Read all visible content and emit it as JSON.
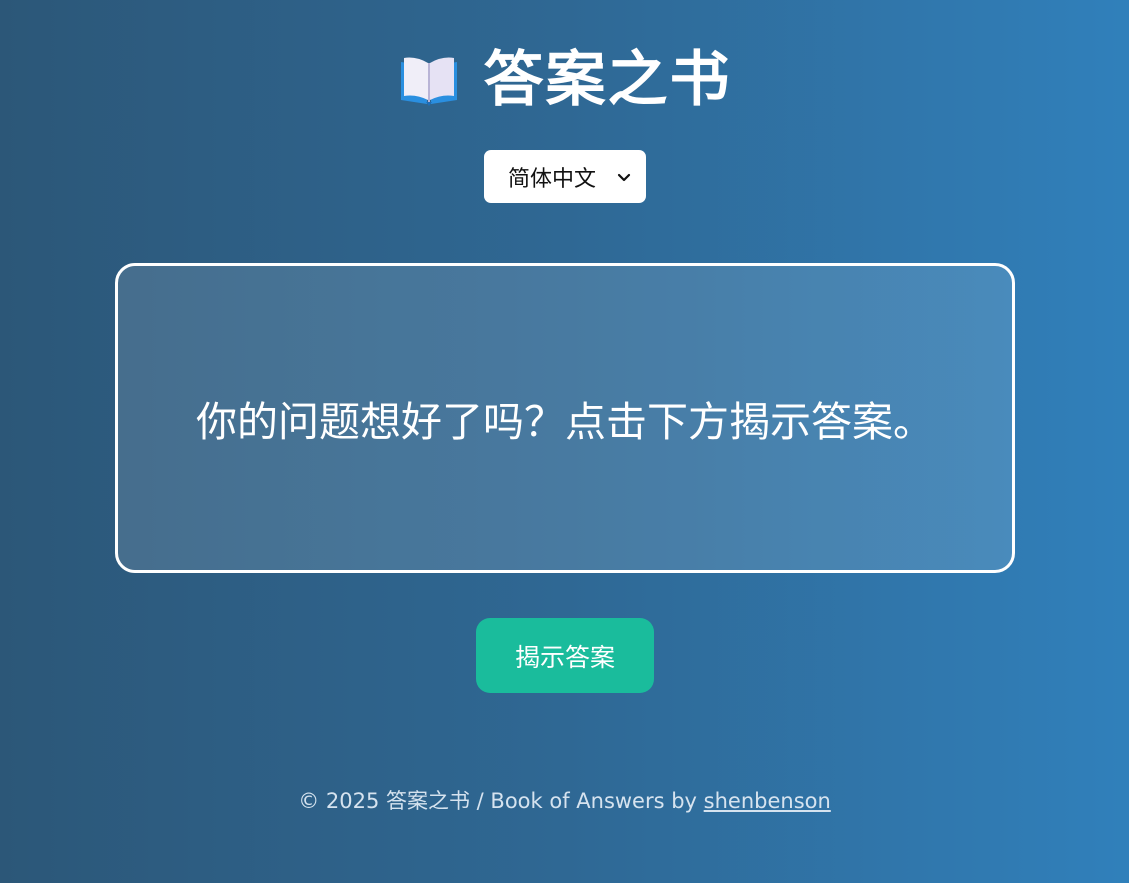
{
  "header": {
    "icon": "open-book-icon",
    "title": "答案之书"
  },
  "language": {
    "selected": "简体中文"
  },
  "answer_card": {
    "text": "你的问题想好了吗？点击下方揭示答案。"
  },
  "actions": {
    "reveal_label": "揭示答案"
  },
  "footer": {
    "text": "© 2025 答案之书 / Book of Answers by ",
    "author_link": "shenbenson"
  },
  "colors": {
    "background_start": "#2c5778",
    "background_end": "#3080bb",
    "button": "#1abc9c",
    "text": "#ffffff"
  }
}
